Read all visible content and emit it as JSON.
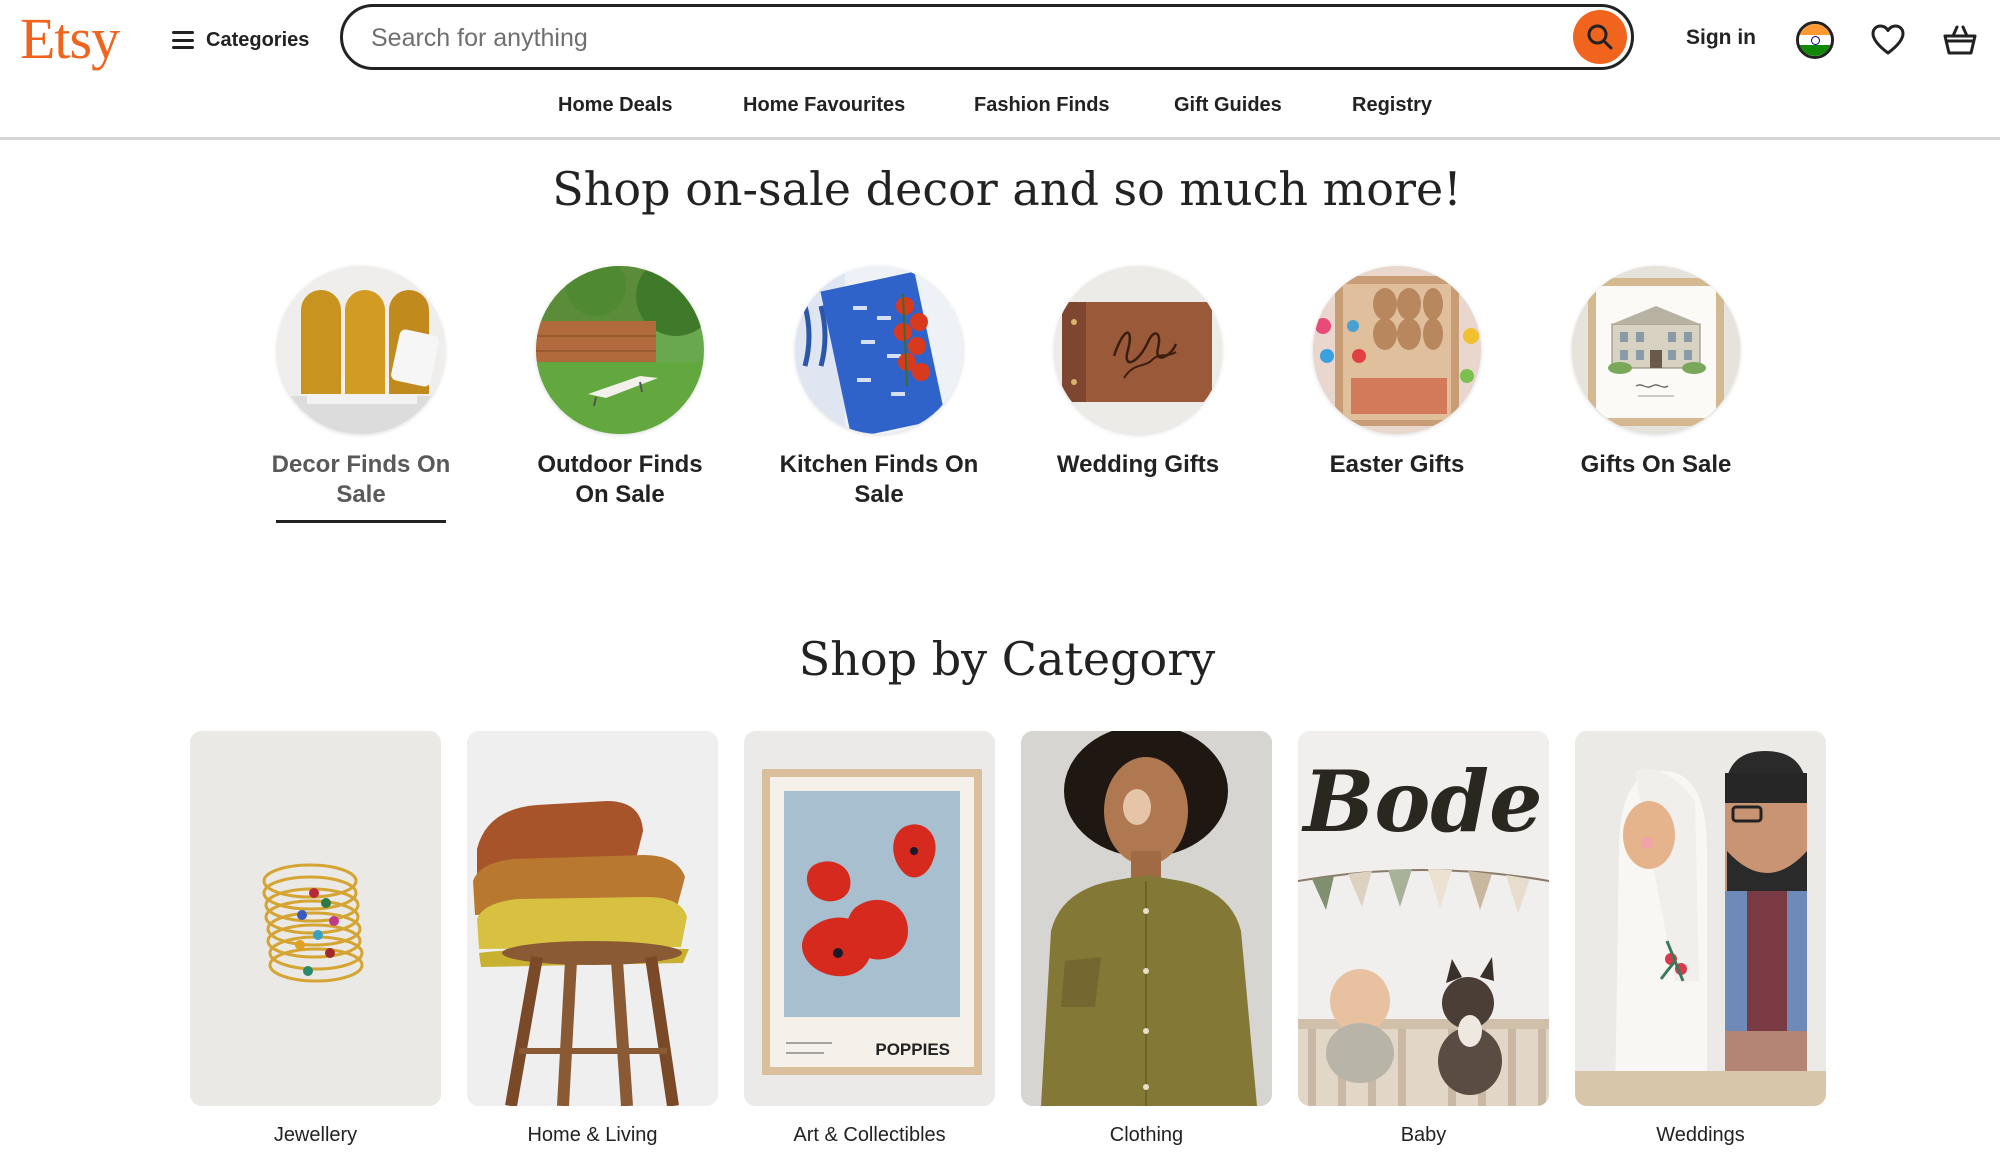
{
  "header": {
    "logo": "Etsy",
    "categories_label": "Categories",
    "search_placeholder": "Search for anything",
    "sign_in_label": "Sign in"
  },
  "nav": {
    "items": [
      "Home Deals",
      "Home Favourites",
      "Fashion Finds",
      "Gift Guides",
      "Registry"
    ]
  },
  "hero": {
    "title": "Shop on-sale decor and so much more!",
    "items": [
      {
        "label": "Decor Finds On Sale",
        "active": true,
        "image": "mustard-headboard"
      },
      {
        "label": "Outdoor Finds On Sale",
        "active": false,
        "image": "garden-lounger"
      },
      {
        "label": "Kitchen Finds On Sale",
        "active": false,
        "image": "blue-towel-tomatoes"
      },
      {
        "label": "Wedding Gifts",
        "active": false,
        "image": "engraved-wood-album"
      },
      {
        "label": "Easter Gifts",
        "active": false,
        "image": "happy-easter-box"
      },
      {
        "label": "Gifts On Sale",
        "active": false,
        "image": "house-portrait-print"
      }
    ]
  },
  "categories": {
    "title": "Shop by Category",
    "items": [
      {
        "label": "Jewellery",
        "image": "gold-stacked-rings"
      },
      {
        "label": "Home & Living",
        "image": "knit-blankets-stool"
      },
      {
        "label": "Art & Collectibles",
        "image": "poppies-print",
        "print_text": "POPPIES"
      },
      {
        "label": "Clothing",
        "image": "olive-linen-shirt"
      },
      {
        "label": "Baby",
        "image": "name-sign-bunting",
        "sign_text": "Bode"
      },
      {
        "label": "Weddings",
        "image": "wooden-couple-figures"
      }
    ]
  },
  "colors": {
    "brand": "#f1641e",
    "text": "#222222",
    "divider": "#d6d6d6"
  }
}
